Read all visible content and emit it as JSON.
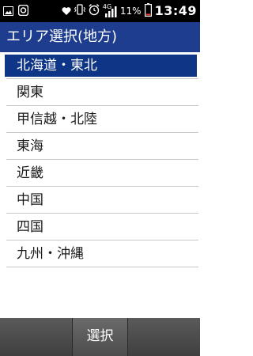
{
  "status_bar": {
    "left_icons": [
      "image-icon",
      "app-o-icon"
    ],
    "right_icons": [
      "heart-icon",
      "vibrate-icon",
      "alarm-icon",
      "signal-icon",
      "battery-icon"
    ],
    "network_label": "4G",
    "battery_percent": "11%",
    "time": "13:49"
  },
  "header": {
    "title": "エリア選択(地方)"
  },
  "list": {
    "selected_index": 0,
    "items": [
      {
        "label": "北海道・東北"
      },
      {
        "label": "関東"
      },
      {
        "label": "甲信越・北陸"
      },
      {
        "label": "東海"
      },
      {
        "label": "近畿"
      },
      {
        "label": "中国"
      },
      {
        "label": "四国"
      },
      {
        "label": "九州・沖縄"
      }
    ]
  },
  "softkeys": {
    "left": "",
    "center": "選択",
    "right": ""
  },
  "colors": {
    "title_bar": "#1f3d8f",
    "selection": "#0e3586",
    "divider": "#c8c8c8",
    "softkey_bar": "#4a4a4a"
  }
}
